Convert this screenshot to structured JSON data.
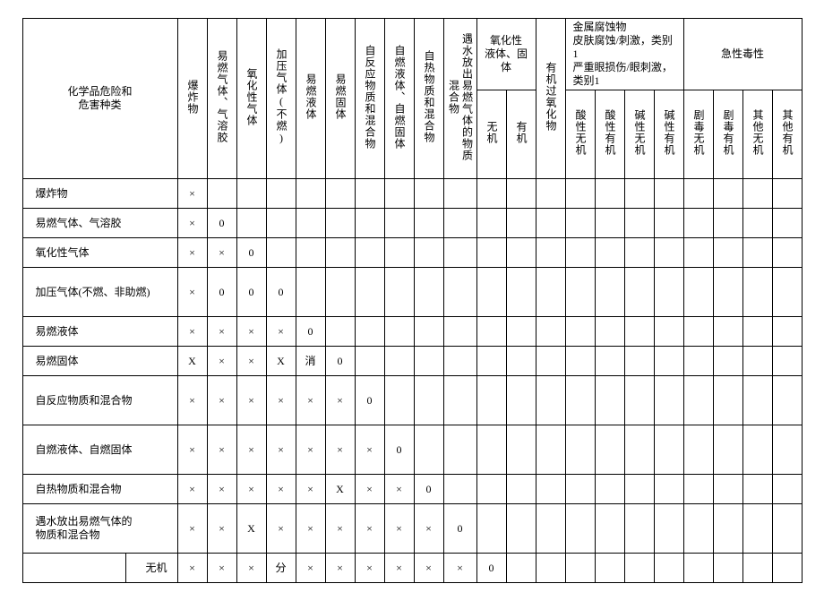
{
  "title": "化学品危险和\n危害种类",
  "group_headers": {
    "oxliquid": "氧化性\n液体、固\n体",
    "corr": "金属腐蚀物\n皮肤腐蚀/刺激，类别 1\n严重眼损伤/眼刺激，类别1",
    "tox": "急性毒性"
  },
  "cols": [
    "爆炸物",
    "易燃气体、气溶胶",
    "氧化性气体",
    "加压气体(不燃)",
    "易燃液体",
    "易燃固体",
    "自反应物质和混合物",
    "自燃液体、自燃固体",
    "自热物质和混合物",
    "遇水放出易燃气体的物质混合物",
    "无机",
    "有机",
    "有机过氧化物",
    "酸性无机",
    "酸性有机",
    "碱性无机",
    "碱性有机",
    "剧毒无机",
    "剧毒有机",
    "其他无机",
    "其他有机"
  ],
  "rows": [
    {
      "label": "爆炸物",
      "cells": [
        "×",
        "",
        "",
        "",
        "",
        "",
        "",
        "",
        "",
        "",
        "",
        "",
        "",
        "",
        "",
        "",
        "",
        "",
        "",
        "",
        ""
      ]
    },
    {
      "label": "易燃气体、气溶胶",
      "cells": [
        "×",
        "0",
        "",
        "",
        "",
        "",
        "",
        "",
        "",
        "",
        "",
        "",
        "",
        "",
        "",
        "",
        "",
        "",
        "",
        "",
        ""
      ]
    },
    {
      "label": "氧化性气体",
      "cells": [
        "×",
        "×",
        "0",
        "",
        "",
        "",
        "",
        "",
        "",
        "",
        "",
        "",
        "",
        "",
        "",
        "",
        "",
        "",
        "",
        "",
        ""
      ]
    },
    {
      "label": "加压气体(不燃、非助燃)",
      "cells": [
        "×",
        "0",
        "0",
        "0",
        "",
        "",
        "",
        "",
        "",
        "",
        "",
        "",
        "",
        "",
        "",
        "",
        "",
        "",
        "",
        "",
        ""
      ]
    },
    {
      "label": "易燃液体",
      "cells": [
        "×",
        "×",
        "×",
        "×",
        "0",
        "",
        "",
        "",
        "",
        "",
        "",
        "",
        "",
        "",
        "",
        "",
        "",
        "",
        "",
        "",
        ""
      ]
    },
    {
      "label": "易燃固体",
      "cells": [
        "X",
        "×",
        "×",
        "X",
        "消",
        "0",
        "",
        "",
        "",
        "",
        "",
        "",
        "",
        "",
        "",
        "",
        "",
        "",
        "",
        "",
        ""
      ]
    },
    {
      "label": "自反应物质和混合物",
      "cells": [
        "×",
        "×",
        "×",
        "×",
        "×",
        "×",
        "0",
        "",
        "",
        "",
        "",
        "",
        "",
        "",
        "",
        "",
        "",
        "",
        "",
        "",
        ""
      ]
    },
    {
      "label": "自燃液体、自燃固体",
      "cells": [
        "×",
        "×",
        "×",
        "×",
        "×",
        "×",
        "×",
        "0",
        "",
        "",
        "",
        "",
        "",
        "",
        "",
        "",
        "",
        "",
        "",
        "",
        ""
      ]
    },
    {
      "label": "自热物质和混合物",
      "cells": [
        "×",
        "×",
        "×",
        "×",
        "×",
        "X",
        "×",
        "×",
        "0",
        "",
        "",
        "",
        "",
        "",
        "",
        "",
        "",
        "",
        "",
        "",
        ""
      ]
    },
    {
      "label": "遇水放出易燃气体的\n    物质和混合物",
      "cells": [
        "×",
        "×",
        "X",
        "×",
        "×",
        "×",
        "×",
        "×",
        "×",
        "0",
        "",
        "",
        "",
        "",
        "",
        "",
        "",
        "",
        "",
        "",
        ""
      ]
    }
  ],
  "lastrow": {
    "label_a": "",
    "label_b": "无机",
    "cells": [
      "×",
      "×",
      "×",
      "分",
      "×",
      "×",
      "×",
      "×",
      "×",
      "×",
      "0",
      "",
      "",
      "",
      "",
      "",
      "",
      "",
      "",
      "",
      ""
    ]
  }
}
